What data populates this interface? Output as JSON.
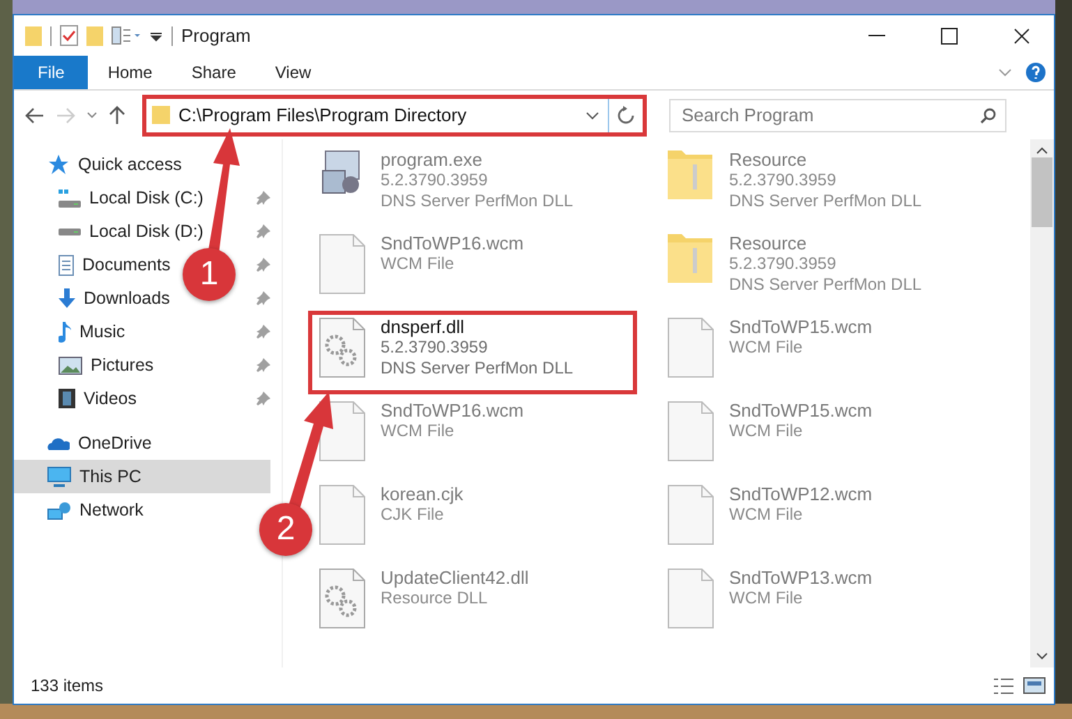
{
  "window": {
    "title": "Program"
  },
  "ribbon_tabs": [
    {
      "label": "File",
      "selected": true
    },
    {
      "label": "Home",
      "selected": false
    },
    {
      "label": "Share",
      "selected": false
    },
    {
      "label": "View",
      "selected": false
    }
  ],
  "address_bar": {
    "path": "C:\\Program Files\\Program Directory",
    "highlighted": true
  },
  "search": {
    "placeholder": "Search Program"
  },
  "sidebar": {
    "items": [
      {
        "label": "Quick access",
        "kind": "star",
        "selected": false,
        "children": [
          {
            "label": "Local Disk (C:)",
            "kind": "system-drive",
            "pinned": true,
            "selected": false
          },
          {
            "label": "Local Disk (D:)",
            "kind": "drive",
            "pinned": true,
            "selected": false
          },
          {
            "label": "Documents",
            "kind": "documents",
            "pinned": true,
            "selected": false
          },
          {
            "label": "Downloads",
            "kind": "downloads",
            "pinned": true,
            "selected": false
          },
          {
            "label": "Music",
            "kind": "music",
            "pinned": true,
            "selected": false
          },
          {
            "label": "Pictures",
            "kind": "pictures",
            "pinned": true,
            "selected": false
          },
          {
            "label": "Videos",
            "kind": "videos",
            "pinned": true,
            "selected": false
          }
        ]
      },
      {
        "label": "OneDrive",
        "kind": "cloud",
        "selected": false
      },
      {
        "label": "This PC",
        "kind": "pc",
        "selected": true
      },
      {
        "label": "Network",
        "kind": "network",
        "selected": false
      }
    ]
  },
  "files": [
    {
      "name": "program.exe",
      "details": [
        "5.2.3790.3959",
        "DNS Server PerfMon DLL"
      ],
      "kind": "exe",
      "highlighted": false
    },
    {
      "name": "Resource",
      "details": [
        "5.2.3790.3959",
        "DNS Server PerfMon DLL"
      ],
      "kind": "folder",
      "highlighted": false
    },
    {
      "name": "SndToWP16.wcm",
      "details": [
        "WCM File"
      ],
      "kind": "file",
      "highlighted": false
    },
    {
      "name": "Resource",
      "details": [
        "5.2.3790.3959",
        "DNS Server PerfMon DLL"
      ],
      "kind": "folder",
      "highlighted": false
    },
    {
      "name": "dnsperf.dll",
      "details": [
        "5.2.3790.3959",
        "DNS Server PerfMon DLL"
      ],
      "kind": "dll",
      "highlighted": true
    },
    {
      "name": "SndToWP15.wcm",
      "details": [
        "WCM File"
      ],
      "kind": "file",
      "highlighted": false
    },
    {
      "name": "SndToWP16.wcm",
      "details": [
        "WCM File"
      ],
      "kind": "file",
      "highlighted": false
    },
    {
      "name": "SndToWP15.wcm",
      "details": [
        "WCM File"
      ],
      "kind": "file",
      "highlighted": false
    },
    {
      "name": "korean.cjk",
      "details": [
        "CJK File"
      ],
      "kind": "file",
      "highlighted": false
    },
    {
      "name": "SndToWP12.wcm",
      "details": [
        "WCM File"
      ],
      "kind": "file",
      "highlighted": false
    },
    {
      "name": "UpdateClient42.dll",
      "details": [
        "Resource DLL"
      ],
      "kind": "dll",
      "highlighted": false
    },
    {
      "name": "SndToWP13.wcm",
      "details": [
        "WCM File"
      ],
      "kind": "file",
      "highlighted": false
    }
  ],
  "status_bar": {
    "item_count": "133 items"
  },
  "callouts": [
    {
      "number": "1"
    },
    {
      "number": "2"
    }
  ]
}
